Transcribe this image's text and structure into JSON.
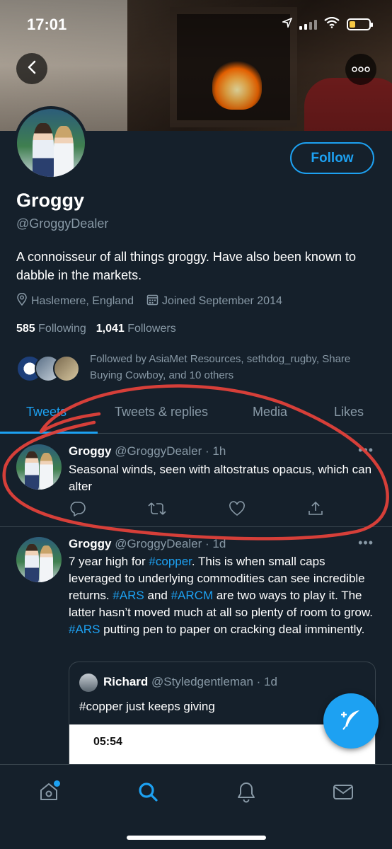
{
  "status_bar": {
    "time": "17:01"
  },
  "profile": {
    "name": "Groggy",
    "handle": "@GroggyDealer",
    "follow_label": "Follow",
    "bio": "A connoisseur of all things groggy. Have also been known to dabble in the markets.",
    "location": "Haslemere, England",
    "joined": "Joined September 2014",
    "following_count": "585",
    "following_label": "Following",
    "followers_count": "1,041",
    "followers_label": "Followers",
    "followed_by": "Followed by AsiaMet Resources, sethdog_rugby, Share Buying Cowboy, and 10 others"
  },
  "tabs": [
    {
      "label": "Tweets",
      "active": true
    },
    {
      "label": "Tweets & replies",
      "active": false
    },
    {
      "label": "Media",
      "active": false
    },
    {
      "label": "Likes",
      "active": false
    }
  ],
  "tweets": [
    {
      "name": "Groggy",
      "handle_time": "@GroggyDealer · 1h",
      "text": "Seasonal winds, seen with altostratus opacus, which can alter"
    },
    {
      "name": "Groggy",
      "handle_time": "@GroggyDealer · 1d",
      "segments": [
        {
          "t": "7 year high for ",
          "link": false
        },
        {
          "t": "#copper",
          "link": true
        },
        {
          "t": ". This is when small caps leveraged to underlying commodities can see incredible returns. ",
          "link": false
        },
        {
          "t": "#ARS",
          "link": true
        },
        {
          "t": " and ",
          "link": false
        },
        {
          "t": "#ARCM",
          "link": true
        },
        {
          "t": " are two ways to play it. The latter hasn’t moved much at all so plenty of room to grow. ",
          "link": false
        },
        {
          "t": "#ARS",
          "link": true
        },
        {
          "t": " putting pen to paper on cracking deal imminently.",
          "link": false
        }
      ],
      "quote": {
        "name": "Richard",
        "handle_time": "@Styledgentleman · 1d",
        "text": "#copper just keeps giving",
        "image_time": "05:54"
      }
    }
  ],
  "colors": {
    "accent": "#1da1f2",
    "background": "#15202b",
    "muted": "#8899a6",
    "annotation": "#e0413a"
  },
  "icons": [
    "back-icon",
    "more-icon",
    "location-icon",
    "calendar-icon",
    "reply-icon",
    "retweet-icon",
    "like-icon",
    "share-icon",
    "compose-icon",
    "home-icon",
    "search-icon",
    "notifications-icon",
    "messages-icon"
  ]
}
